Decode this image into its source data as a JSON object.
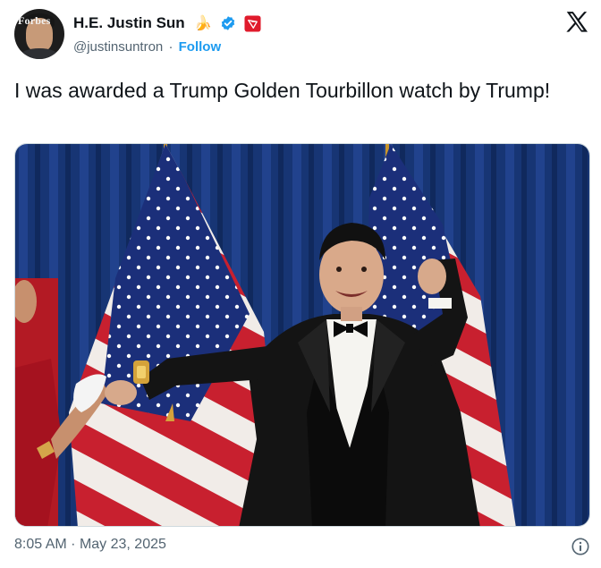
{
  "author": {
    "display_name": "H.E. Justin Sun",
    "emoji": "🍌",
    "avatar_brand": "Forbes",
    "handle": "@justinsuntron",
    "separator": "·",
    "follow_label": "Follow",
    "verified_color": "#1d9bf0",
    "badge_color": "#e01b2c"
  },
  "tweet": {
    "text": "I was awarded a Trump Golden Tourbillon watch by Trump!"
  },
  "meta": {
    "time": "8:05 AM",
    "separator": "·",
    "date": "May 23, 2025"
  },
  "icons": {
    "x_logo": "x-logo-icon",
    "verified": "verified-badge-icon",
    "badge": "tron-badge-icon",
    "info": "info-icon"
  }
}
